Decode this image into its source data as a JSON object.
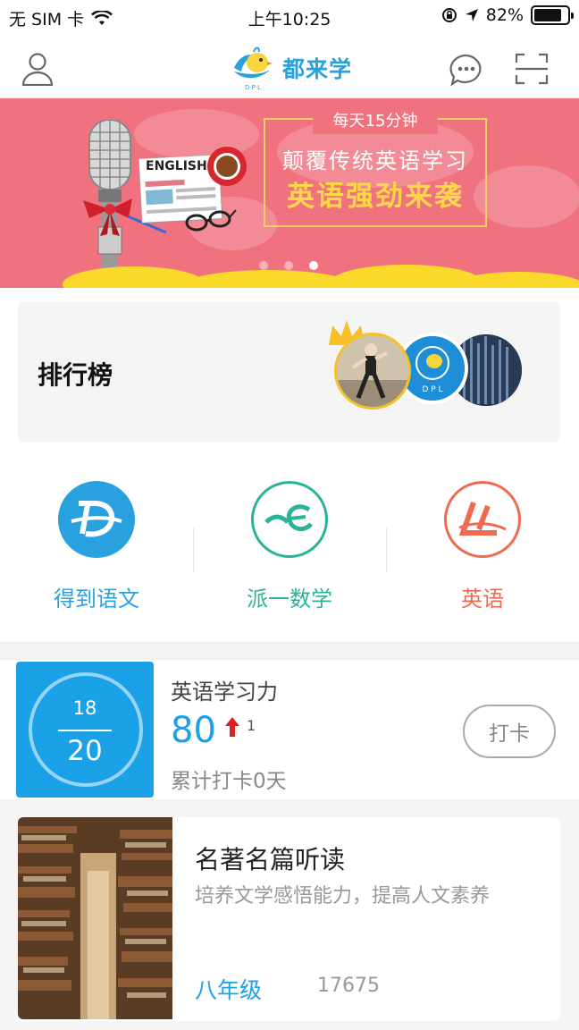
{
  "status_bar": {
    "carrier": "无 SIM 卡",
    "time": "上午10:25",
    "battery_percent": "82%",
    "battery_level": 0.82
  },
  "nav": {
    "brand": "都来学",
    "logo_caption": "D·P·L",
    "icons": [
      "user-icon",
      "message-icon",
      "scan-icon"
    ]
  },
  "banner": {
    "tag": "每天15分钟",
    "line1": "颠覆传统英语学习",
    "line2": "英语强劲来袭",
    "paper_label": "ENGLISH",
    "active_slide": 3,
    "slide_count": 3,
    "colors": {
      "background": "#f0727f",
      "highlight": "#ffd84a"
    }
  },
  "ranking": {
    "title": "排行榜"
  },
  "subjects": [
    {
      "label": "得到语文",
      "color": "#2aa1df"
    },
    {
      "label": "派一数学",
      "color": "#2bb39a"
    },
    {
      "label": "英语",
      "color": "#ee6b50"
    }
  ],
  "study": {
    "current": "18",
    "total": "20",
    "label": "英语学习力",
    "score": "80",
    "delta": "1",
    "days_text": "累计打卡0天",
    "checkin_label": "打卡"
  },
  "course": {
    "title": "名著名篇听读",
    "desc": "培养文学感悟能力，提高人文素养",
    "grade": "八年级",
    "count": "17675"
  }
}
